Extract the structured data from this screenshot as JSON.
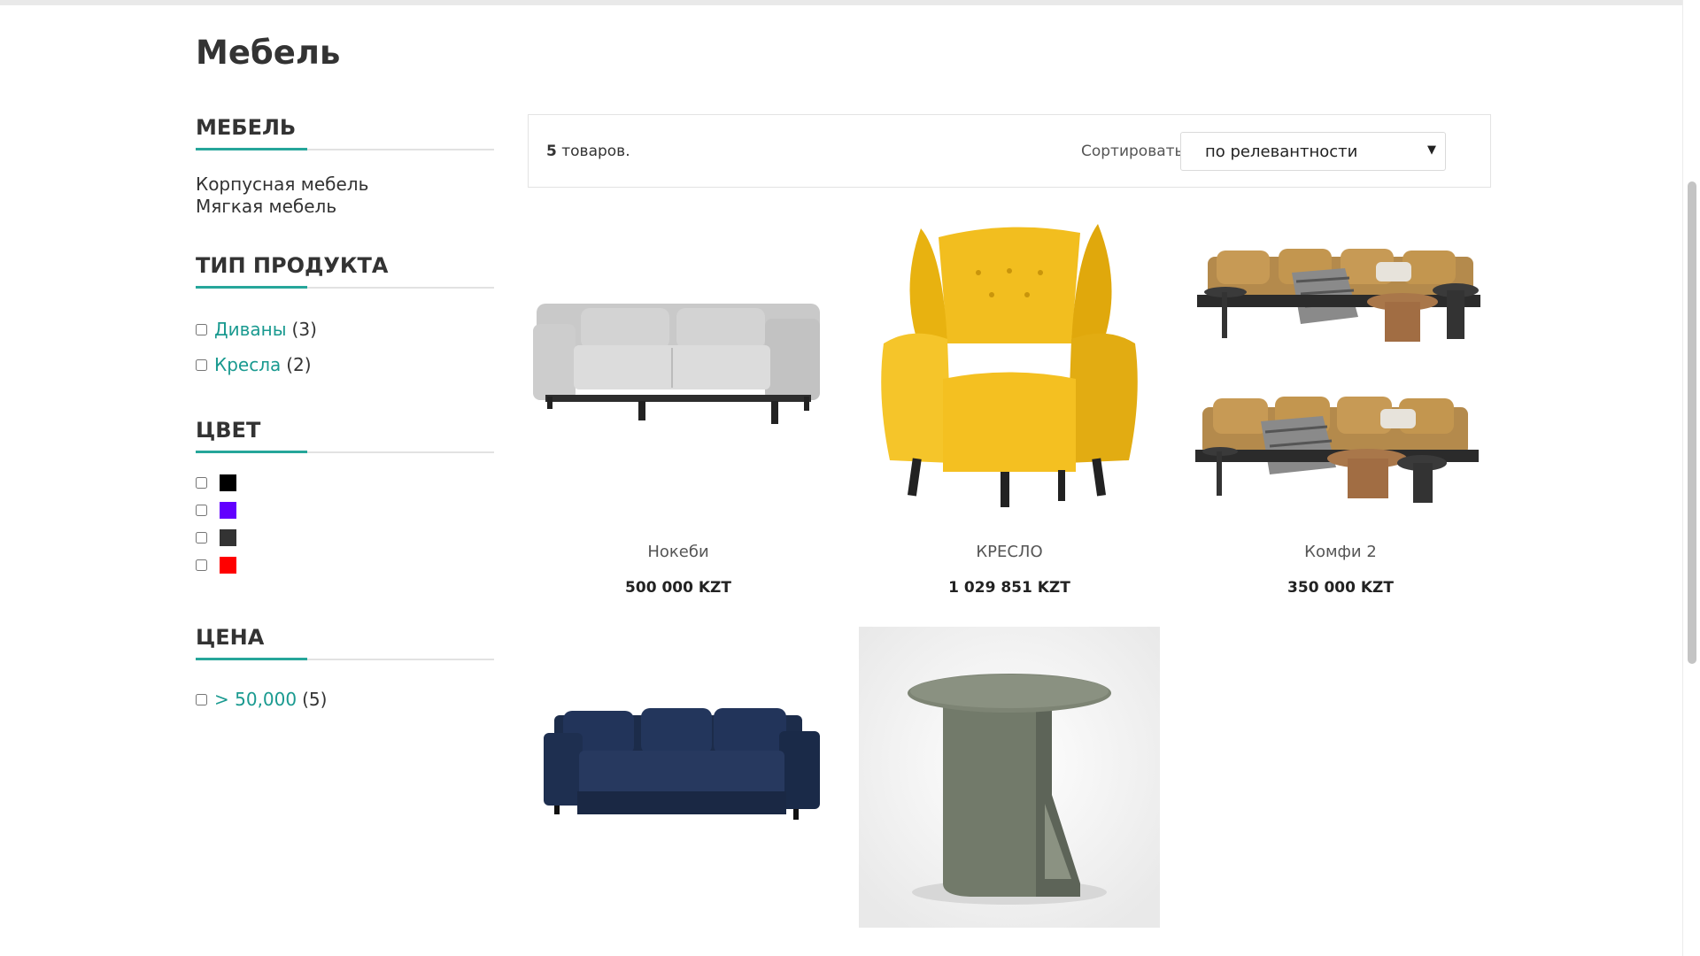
{
  "page": {
    "title": "Мебель"
  },
  "sidebar": {
    "categories": {
      "title": "Мебель",
      "items": [
        "Корпусная мебель",
        "Мягкая мебель"
      ]
    },
    "product_type": {
      "title": "Тип продукта",
      "items": [
        {
          "label": "Диваны",
          "count": "(3)"
        },
        {
          "label": "Кресла",
          "count": "(2)"
        }
      ]
    },
    "color": {
      "title": "Цвет",
      "swatches": [
        "#000000",
        "#6200ff",
        "#333333",
        "#ff0000"
      ]
    },
    "price": {
      "title": "Цена",
      "items": [
        {
          "label": "> 50,000",
          "count": "(5)"
        }
      ]
    }
  },
  "toolbar": {
    "count_number": "5",
    "count_suffix": " товаров.",
    "sort_label": "Сортировать",
    "sort_value": "по релевантности"
  },
  "products": [
    {
      "name": "Нокеби",
      "price": "500 000 KZT",
      "image": "grey-sofa"
    },
    {
      "name": "КРЕСЛО",
      "price": "1 029 851 KZT",
      "image": "yellow-armchair"
    },
    {
      "name": "Комфи 2",
      "price": "350 000 KZT",
      "image": "tan-sofas"
    },
    {
      "name": "",
      "price": "",
      "image": "navy-sofa"
    },
    {
      "name": "",
      "price": "",
      "image": "side-table"
    }
  ],
  "colors": {
    "accent": "#26a69a",
    "link": "#1a9a90"
  }
}
